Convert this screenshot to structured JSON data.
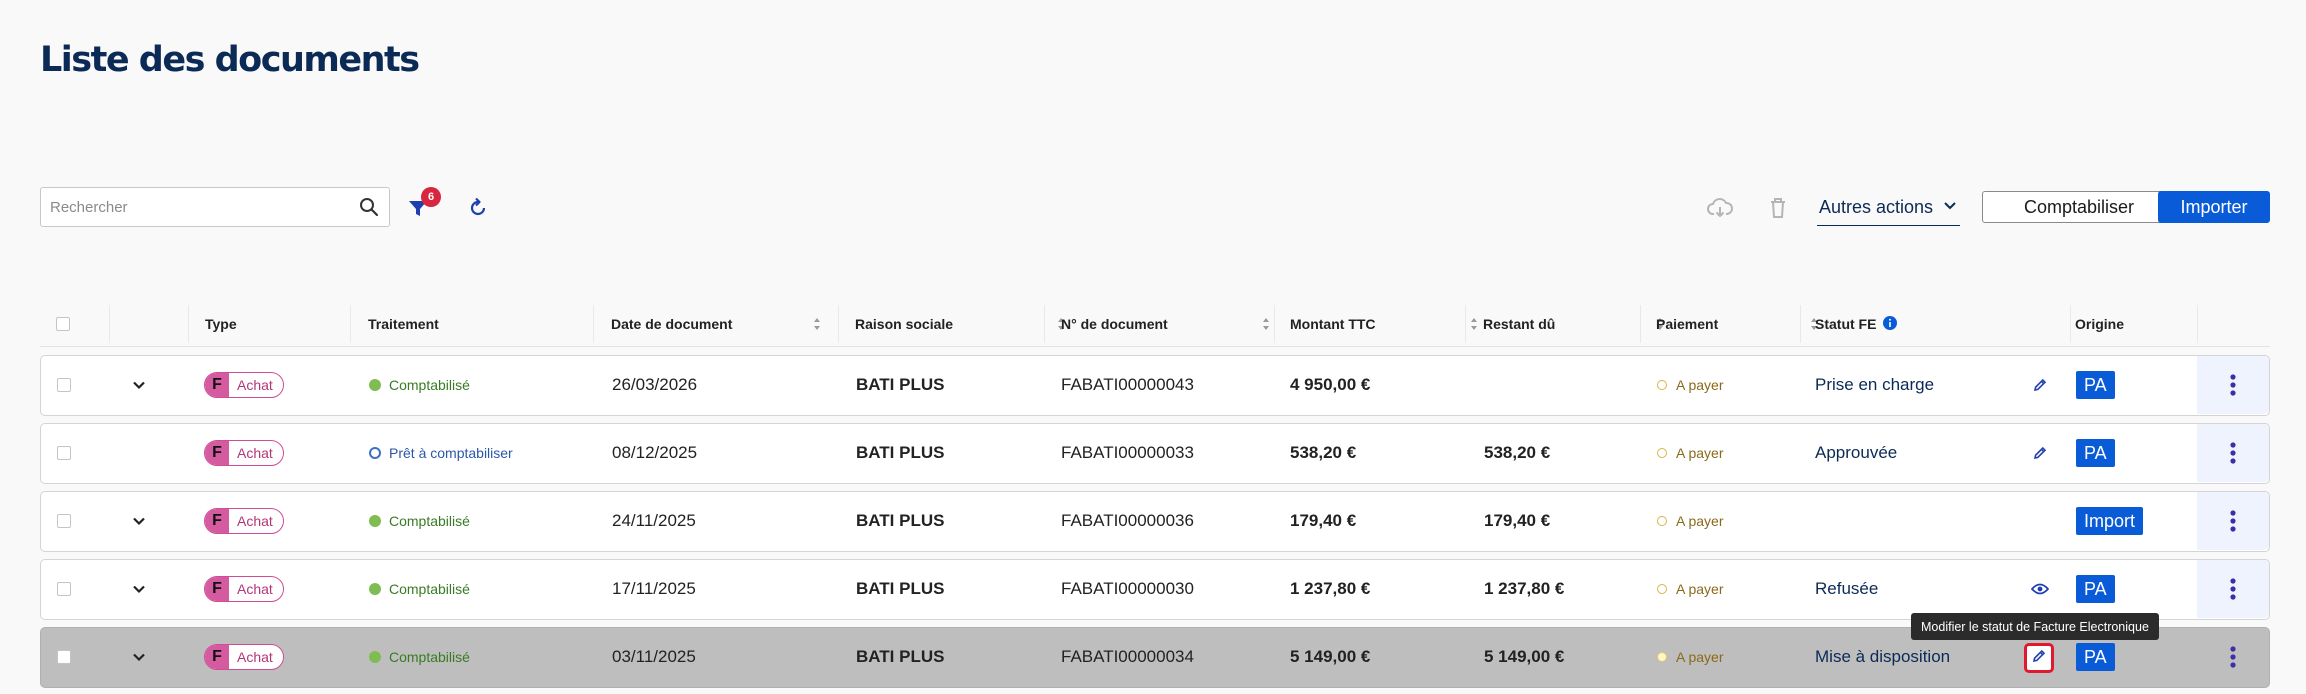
{
  "page": {
    "title": "Liste des documents"
  },
  "toolbar": {
    "search_placeholder": "Rechercher",
    "filter_badge": "6",
    "autres_actions": "Autres actions",
    "comptabiliser": "Comptabiliser",
    "importer": "Importer"
  },
  "table": {
    "headers": {
      "type": "Type",
      "traitement": "Traitement",
      "date": "Date de document",
      "raison": "Raison sociale",
      "numero": "N° de document",
      "montant": "Montant TTC",
      "restant": "Restant dû",
      "paiement": "Paiement",
      "statut_fe": "Statut FE",
      "origine": "Origine"
    },
    "rows": [
      {
        "type_letter": "F",
        "type_label": "Achat",
        "traitement": "Comptabilisé",
        "date": "26/03/2026",
        "raison": "BATI PLUS",
        "numero": "FABATI00000043",
        "montant": "4 950,00 €",
        "restant": "",
        "paiement": "A payer",
        "statut_fe": "Prise en charge",
        "origine": "PA"
      },
      {
        "type_letter": "F",
        "type_label": "Achat",
        "traitement": "Prêt à comptabiliser",
        "date": "08/12/2025",
        "raison": "BATI PLUS",
        "numero": "FABATI00000033",
        "montant": "538,20 €",
        "restant": "538,20 €",
        "paiement": "A payer",
        "statut_fe": "Approuvée",
        "origine": "PA"
      },
      {
        "type_letter": "F",
        "type_label": "Achat",
        "traitement": "Comptabilisé",
        "date": "24/11/2025",
        "raison": "BATI PLUS",
        "numero": "FABATI00000036",
        "montant": "179,40 €",
        "restant": "179,40 €",
        "paiement": "A payer",
        "statut_fe": "",
        "origine": "Import"
      },
      {
        "type_letter": "F",
        "type_label": "Achat",
        "traitement": "Comptabilisé",
        "date": "17/11/2025",
        "raison": "BATI PLUS",
        "numero": "FABATI00000030",
        "montant": "1 237,80 €",
        "restant": "1 237,80 €",
        "paiement": "A payer",
        "statut_fe": "Refusée",
        "origine": "PA"
      },
      {
        "type_letter": "F",
        "type_label": "Achat",
        "traitement": "Comptabilisé",
        "date": "03/11/2025",
        "raison": "BATI PLUS",
        "numero": "FABATI00000034",
        "montant": "5 149,00 €",
        "restant": "5 149,00 €",
        "paiement": "A payer",
        "statut_fe": "Mise à disposition",
        "origine": "PA"
      }
    ]
  },
  "tooltip": {
    "text": "Modifier le statut de Facture Electronique"
  },
  "colors": {
    "accent": "#0a5bd8",
    "title": "#0b2a55",
    "achat": "#d45ba0",
    "badge": "#d7263d"
  }
}
